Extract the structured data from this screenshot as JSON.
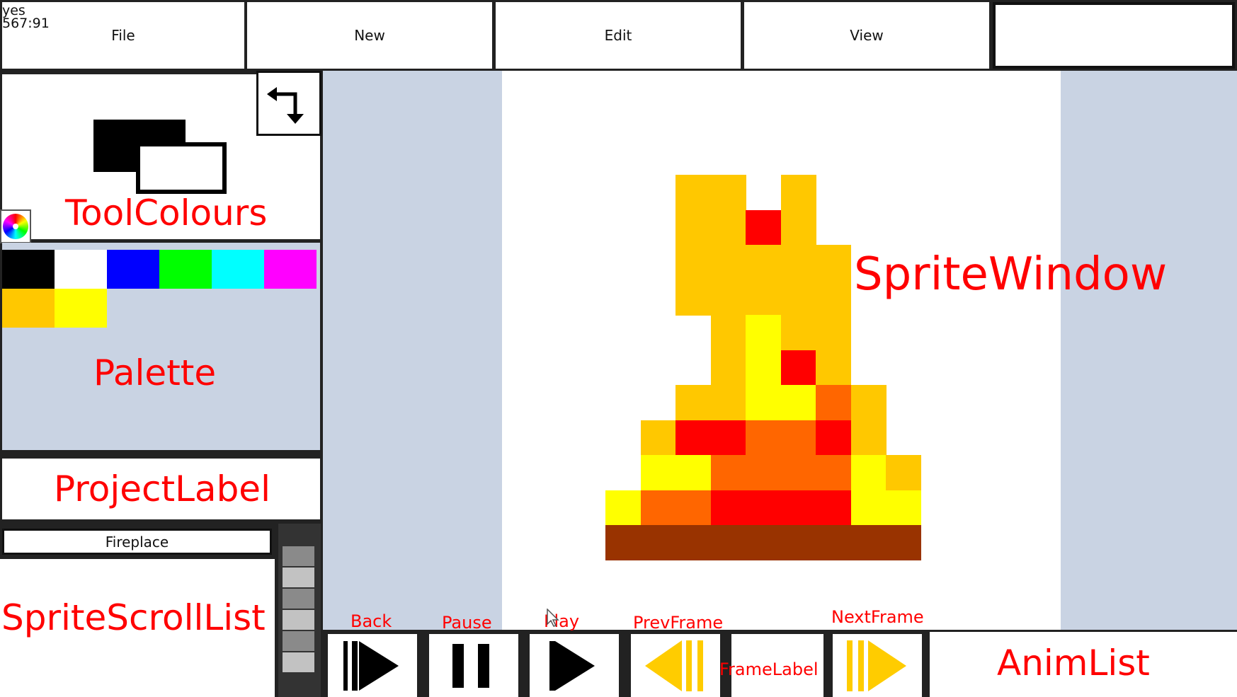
{
  "menu": {
    "debug_line1": "yes",
    "debug_line2": "567:91",
    "items": [
      "File",
      "New",
      "Edit",
      "View"
    ]
  },
  "labels": {
    "tool_colours": "ToolColours",
    "palette": "Palette",
    "project_label": "ProjectLabel",
    "sprite_scroll_list": "SpriteScrollList",
    "sprite_window": "SpriteWindow",
    "anim_list": "AnimList",
    "frame_label": "FrameLabel",
    "back": "Back",
    "pause": "Pause",
    "play": "Play",
    "prev_frame": "PrevFrame",
    "next_frame": "NextFrame"
  },
  "sprite_list": {
    "items": [
      "Fireplace"
    ]
  },
  "tool_colours": {
    "foreground": "#000000",
    "background": "#ffffff"
  },
  "palette": {
    "colours": [
      "#000000",
      "#ffffff",
      "#0000ff",
      "#00ff00",
      "#00ffff",
      "#ff00ff",
      "#ffc800",
      "#ffff00"
    ]
  },
  "colors": {
    "panel_bg": "#c9d3e3",
    "label_red": "#ff0000",
    "transport_yellow": "#ffcc00"
  },
  "icons": {
    "swap": "swap-colours-icon",
    "colour_wheel": "colour-wheel-icon",
    "back": "skip-back-icon",
    "pause": "pause-icon",
    "play": "play-icon",
    "prev_frame": "prev-frame-icon",
    "next_frame": "next-frame-icon"
  }
}
